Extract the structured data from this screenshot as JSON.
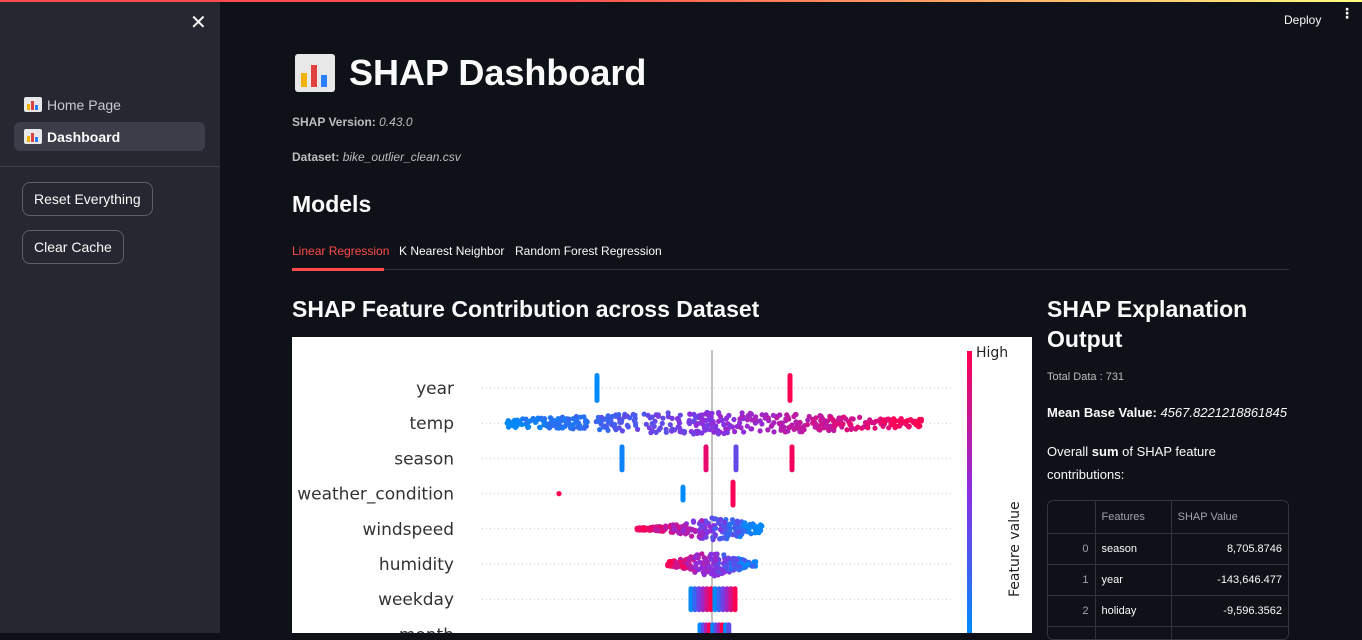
{
  "header": {
    "deploy_label": "Deploy",
    "menu_glyph": "⋮"
  },
  "sidebar": {
    "close_glyph": "✕",
    "items": [
      {
        "label": "Home Page",
        "icon": "bar-chart-icon"
      },
      {
        "label": "Dashboard",
        "icon": "bar-chart-icon"
      }
    ],
    "buttons": {
      "reset": "Reset Everything",
      "clear": "Clear Cache"
    }
  },
  "main": {
    "title": "SHAP Dashboard",
    "shap_version_label": "SHAP Version:",
    "shap_version": "0.43.0",
    "dataset_label": "Dataset:",
    "dataset": "bike_outlier_clean.csv",
    "models_heading": "Models",
    "tabs": [
      {
        "label": "Linear Regression",
        "active": true
      },
      {
        "label": "K Nearest Neighbor",
        "active": false
      },
      {
        "label": "Random Forest Regression",
        "active": false
      }
    ],
    "plot_heading": "SHAP Feature Contribution across Dataset"
  },
  "chart_data": {
    "type": "scatter",
    "subtype": "shap-beeswarm",
    "features": [
      "year",
      "temp",
      "season",
      "weather_condition",
      "windspeed",
      "humidity",
      "weekday",
      "month"
    ],
    "colorbar": {
      "high_label": "High",
      "axis_label": "Feature value",
      "low_color": "#008bfb",
      "high_color": "#ff0051"
    }
  },
  "explanation": {
    "heading": "SHAP Explanation Output",
    "total_data": "Total Data : 731",
    "mean_label": "Mean Base Value:",
    "mean_value": "4567.8221218861845",
    "overall_prefix": "Overall ",
    "overall_bold": "sum",
    "overall_suffix": " of SHAP feature contributions:",
    "table": {
      "columns": [
        "",
        "Features",
        "SHAP Value"
      ],
      "rows": [
        {
          "idx": "0",
          "feature": "season",
          "value": "8,705.8746"
        },
        {
          "idx": "1",
          "feature": "year",
          "value": "-143,646.477"
        },
        {
          "idx": "2",
          "feature": "holiday",
          "value": "-9,596.3562"
        }
      ]
    }
  }
}
